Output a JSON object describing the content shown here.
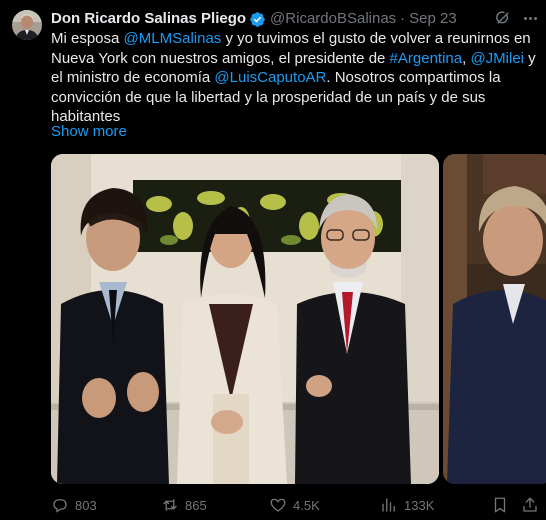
{
  "author": {
    "display_name": "Don Ricardo Salinas Pliego",
    "handle": "@RicardoBSalinas",
    "separator": "·",
    "date": "Sep 23",
    "avatar_icon": "avatar-photo",
    "verified_icon": "verified-badge-icon"
  },
  "tweet": {
    "segments": [
      {
        "type": "text",
        "value": "Mi esposa "
      },
      {
        "type": "mention",
        "value": "@MLMSalinas"
      },
      {
        "type": "text",
        "value": " y yo tuvimos el gusto de volver a reunirnos en Nueva York con nuestros amigos, el presidente de "
      },
      {
        "type": "hashtag",
        "value": "#Argentina"
      },
      {
        "type": "text",
        "value": ", "
      },
      {
        "type": "mention",
        "value": "@JMilei"
      },
      {
        "type": "text",
        "value": " y el ministro de economía "
      },
      {
        "type": "mention",
        "value": "@LuisCaputoAR"
      },
      {
        "type": "text",
        "value": ". Nosotros compartimos la convicción de que la libertad y la prosperidad de un país y de sus habitantes"
      }
    ],
    "show_more": "Show more"
  },
  "media": {
    "photos": [
      {
        "icon": "group-photo"
      },
      {
        "icon": "partial-photo"
      }
    ]
  },
  "actions": {
    "replies": {
      "icon": "reply-icon",
      "count": "803"
    },
    "reposts": {
      "icon": "repost-icon",
      "count": "865"
    },
    "likes": {
      "icon": "like-icon",
      "count": "4.5K"
    },
    "views": {
      "icon": "views-icon",
      "count": "133K"
    },
    "bookmark": {
      "icon": "bookmark-icon"
    },
    "share": {
      "icon": "share-icon"
    }
  },
  "header_icons": {
    "grok": "grok-icon",
    "more": "more-icon"
  },
  "colors": {
    "background": "#000000",
    "text": "#e7e9ea",
    "secondary": "#71767b",
    "link": "#1d9bf0"
  }
}
